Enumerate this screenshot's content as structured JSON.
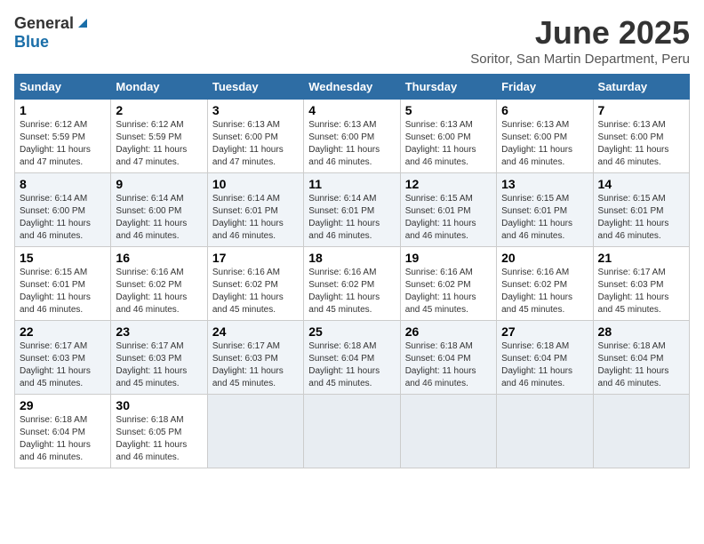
{
  "logo": {
    "general": "General",
    "blue": "Blue"
  },
  "title": {
    "month": "June 2025",
    "location": "Soritor, San Martin Department, Peru"
  },
  "weekdays": [
    "Sunday",
    "Monday",
    "Tuesday",
    "Wednesday",
    "Thursday",
    "Friday",
    "Saturday"
  ],
  "weeks": [
    [
      {
        "day": "1",
        "sunrise": "6:12 AM",
        "sunset": "5:59 PM",
        "daylight": "11 hours and 47 minutes."
      },
      {
        "day": "2",
        "sunrise": "6:12 AM",
        "sunset": "5:59 PM",
        "daylight": "11 hours and 47 minutes."
      },
      {
        "day": "3",
        "sunrise": "6:13 AM",
        "sunset": "6:00 PM",
        "daylight": "11 hours and 47 minutes."
      },
      {
        "day": "4",
        "sunrise": "6:13 AM",
        "sunset": "6:00 PM",
        "daylight": "11 hours and 46 minutes."
      },
      {
        "day": "5",
        "sunrise": "6:13 AM",
        "sunset": "6:00 PM",
        "daylight": "11 hours and 46 minutes."
      },
      {
        "day": "6",
        "sunrise": "6:13 AM",
        "sunset": "6:00 PM",
        "daylight": "11 hours and 46 minutes."
      },
      {
        "day": "7",
        "sunrise": "6:13 AM",
        "sunset": "6:00 PM",
        "daylight": "11 hours and 46 minutes."
      }
    ],
    [
      {
        "day": "8",
        "sunrise": "6:14 AM",
        "sunset": "6:00 PM",
        "daylight": "11 hours and 46 minutes."
      },
      {
        "day": "9",
        "sunrise": "6:14 AM",
        "sunset": "6:00 PM",
        "daylight": "11 hours and 46 minutes."
      },
      {
        "day": "10",
        "sunrise": "6:14 AM",
        "sunset": "6:01 PM",
        "daylight": "11 hours and 46 minutes."
      },
      {
        "day": "11",
        "sunrise": "6:14 AM",
        "sunset": "6:01 PM",
        "daylight": "11 hours and 46 minutes."
      },
      {
        "day": "12",
        "sunrise": "6:15 AM",
        "sunset": "6:01 PM",
        "daylight": "11 hours and 46 minutes."
      },
      {
        "day": "13",
        "sunrise": "6:15 AM",
        "sunset": "6:01 PM",
        "daylight": "11 hours and 46 minutes."
      },
      {
        "day": "14",
        "sunrise": "6:15 AM",
        "sunset": "6:01 PM",
        "daylight": "11 hours and 46 minutes."
      }
    ],
    [
      {
        "day": "15",
        "sunrise": "6:15 AM",
        "sunset": "6:01 PM",
        "daylight": "11 hours and 46 minutes."
      },
      {
        "day": "16",
        "sunrise": "6:16 AM",
        "sunset": "6:02 PM",
        "daylight": "11 hours and 46 minutes."
      },
      {
        "day": "17",
        "sunrise": "6:16 AM",
        "sunset": "6:02 PM",
        "daylight": "11 hours and 45 minutes."
      },
      {
        "day": "18",
        "sunrise": "6:16 AM",
        "sunset": "6:02 PM",
        "daylight": "11 hours and 45 minutes."
      },
      {
        "day": "19",
        "sunrise": "6:16 AM",
        "sunset": "6:02 PM",
        "daylight": "11 hours and 45 minutes."
      },
      {
        "day": "20",
        "sunrise": "6:16 AM",
        "sunset": "6:02 PM",
        "daylight": "11 hours and 45 minutes."
      },
      {
        "day": "21",
        "sunrise": "6:17 AM",
        "sunset": "6:03 PM",
        "daylight": "11 hours and 45 minutes."
      }
    ],
    [
      {
        "day": "22",
        "sunrise": "6:17 AM",
        "sunset": "6:03 PM",
        "daylight": "11 hours and 45 minutes."
      },
      {
        "day": "23",
        "sunrise": "6:17 AM",
        "sunset": "6:03 PM",
        "daylight": "11 hours and 45 minutes."
      },
      {
        "day": "24",
        "sunrise": "6:17 AM",
        "sunset": "6:03 PM",
        "daylight": "11 hours and 45 minutes."
      },
      {
        "day": "25",
        "sunrise": "6:18 AM",
        "sunset": "6:04 PM",
        "daylight": "11 hours and 45 minutes."
      },
      {
        "day": "26",
        "sunrise": "6:18 AM",
        "sunset": "6:04 PM",
        "daylight": "11 hours and 46 minutes."
      },
      {
        "day": "27",
        "sunrise": "6:18 AM",
        "sunset": "6:04 PM",
        "daylight": "11 hours and 46 minutes."
      },
      {
        "day": "28",
        "sunrise": "6:18 AM",
        "sunset": "6:04 PM",
        "daylight": "11 hours and 46 minutes."
      }
    ],
    [
      {
        "day": "29",
        "sunrise": "6:18 AM",
        "sunset": "6:04 PM",
        "daylight": "11 hours and 46 minutes."
      },
      {
        "day": "30",
        "sunrise": "6:18 AM",
        "sunset": "6:05 PM",
        "daylight": "11 hours and 46 minutes."
      },
      null,
      null,
      null,
      null,
      null
    ]
  ],
  "labels": {
    "sunrise_prefix": "Sunrise: ",
    "sunset_prefix": "Sunset: ",
    "daylight_prefix": "Daylight: "
  }
}
